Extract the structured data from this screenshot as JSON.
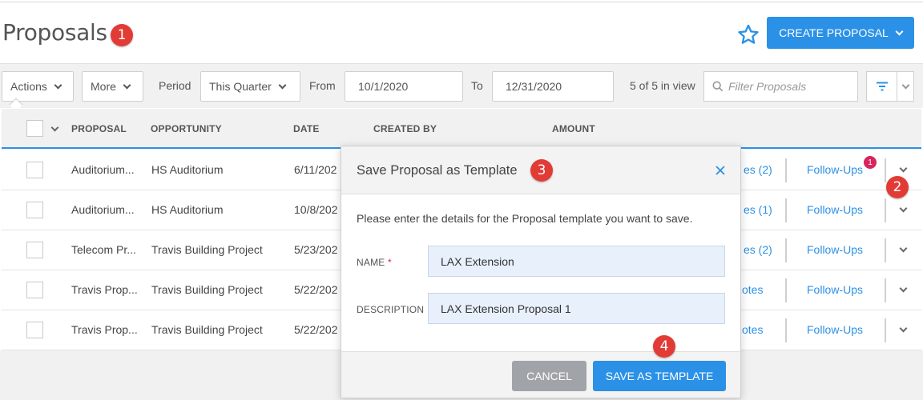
{
  "page": {
    "title": "Proposals"
  },
  "markers": [
    "1",
    "2",
    "3",
    "4"
  ],
  "header": {
    "create_label": "CREATE PROPOSAL",
    "star_icon": "star-icon"
  },
  "toolbar": {
    "actions_label": "Actions",
    "more_label": "More",
    "period_label": "Period",
    "period_value": "This Quarter",
    "from_label": "From",
    "from_value": "10/1/2020",
    "to_label": "To",
    "to_value": "12/31/2020",
    "count_text": "5 of 5 in view",
    "filter_placeholder": "Filter Proposals"
  },
  "table": {
    "headers": [
      "PROPOSAL",
      "OPPORTUNITY",
      "DATE",
      "CREATED BY",
      "AMOUNT"
    ],
    "rows": [
      {
        "proposal": "Auditorium...",
        "opportunity": "HS Auditorium",
        "date": "6/11/202",
        "notes": "es (2)",
        "followups": "Follow-Ups"
      },
      {
        "proposal": "Auditorium...",
        "opportunity": "HS Auditorium",
        "date": "10/8/202",
        "notes": "es (1)",
        "followups": "Follow-Ups"
      },
      {
        "proposal": "Telecom Pr...",
        "opportunity": "Travis Building Project",
        "date": "5/23/202",
        "notes": "es (2)",
        "followups": "Follow-Ups"
      },
      {
        "proposal": "Travis Prop...",
        "opportunity": "Travis Building Project",
        "date": "5/22/202",
        "notes": "otes",
        "followups": "Follow-Ups"
      },
      {
        "proposal": "Travis Prop...",
        "opportunity": "Travis Building Project",
        "date": "5/22/202",
        "notes": "otes",
        "followups": "Follow-Ups"
      }
    ],
    "followup_badge": "1"
  },
  "modal": {
    "title": "Save Proposal as Template",
    "message": "Please enter the details for the Proposal template you want to save.",
    "name_label": "NAME",
    "required_mark": "*",
    "name_value": "LAX Extension",
    "description_label": "DESCRIPTION",
    "description_value": "LAX Extension Proposal 1",
    "cancel_label": "CANCEL",
    "save_label": "SAVE AS TEMPLATE"
  },
  "colors": {
    "accent": "#2b91e6",
    "marker": "#e23b36",
    "badge": "#d9245c",
    "cancel": "#a0a4a8"
  }
}
